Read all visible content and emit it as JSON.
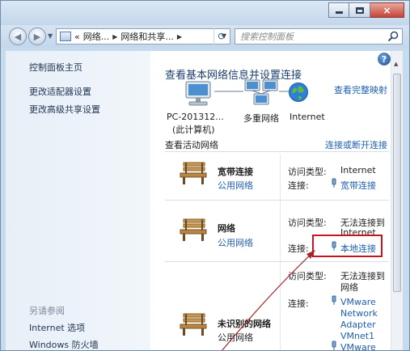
{
  "window": {
    "controls": {
      "minimize": "minimize",
      "maximize": "maximize",
      "close": "×"
    }
  },
  "address_bar": {
    "prefix": "«",
    "segments": [
      "网络...",
      "网络和共享..."
    ]
  },
  "search": {
    "placeholder": "搜索控制面板"
  },
  "sidebar": {
    "links": [
      "控制面板主页",
      "更改适配器设置",
      "更改高级共享设置"
    ],
    "see_also_heading": "另请参阅",
    "see_also_links": [
      "Internet 选项",
      "Windows 防火墙"
    ]
  },
  "main": {
    "title": "查看基本网络信息并设置连接",
    "full_map_link": "查看完整映射",
    "map": {
      "nodes": [
        {
          "label_line1": "PC-201312...",
          "label_line2": "(此计算机)"
        },
        {
          "label_line1": "多重网络",
          "label_line2": ""
        },
        {
          "label_line1": "Internet",
          "label_line2": ""
        }
      ]
    },
    "active_networks_heading": "查看活动网络",
    "connect_disconnect_link": "连接或断开连接",
    "access_type_label": "访问类型:",
    "connection_label": "连接:",
    "networks": [
      {
        "name": "宽带连接",
        "category": "公用网络",
        "access": [
          "Internet"
        ],
        "connections": [
          "宽带连接"
        ]
      },
      {
        "name": "网络",
        "category": "公用网络",
        "access": [
          "无法连接到",
          "Internet"
        ],
        "connections": [
          "本地连接"
        ]
      },
      {
        "name": "未识别的网络",
        "category": "公用网络",
        "access": [
          "无法连接到",
          "网络"
        ],
        "connections": [
          "VMware",
          "Network",
          "Adapter",
          "VMnet1"
        ]
      }
    ],
    "partial_connection": "VMware"
  }
}
